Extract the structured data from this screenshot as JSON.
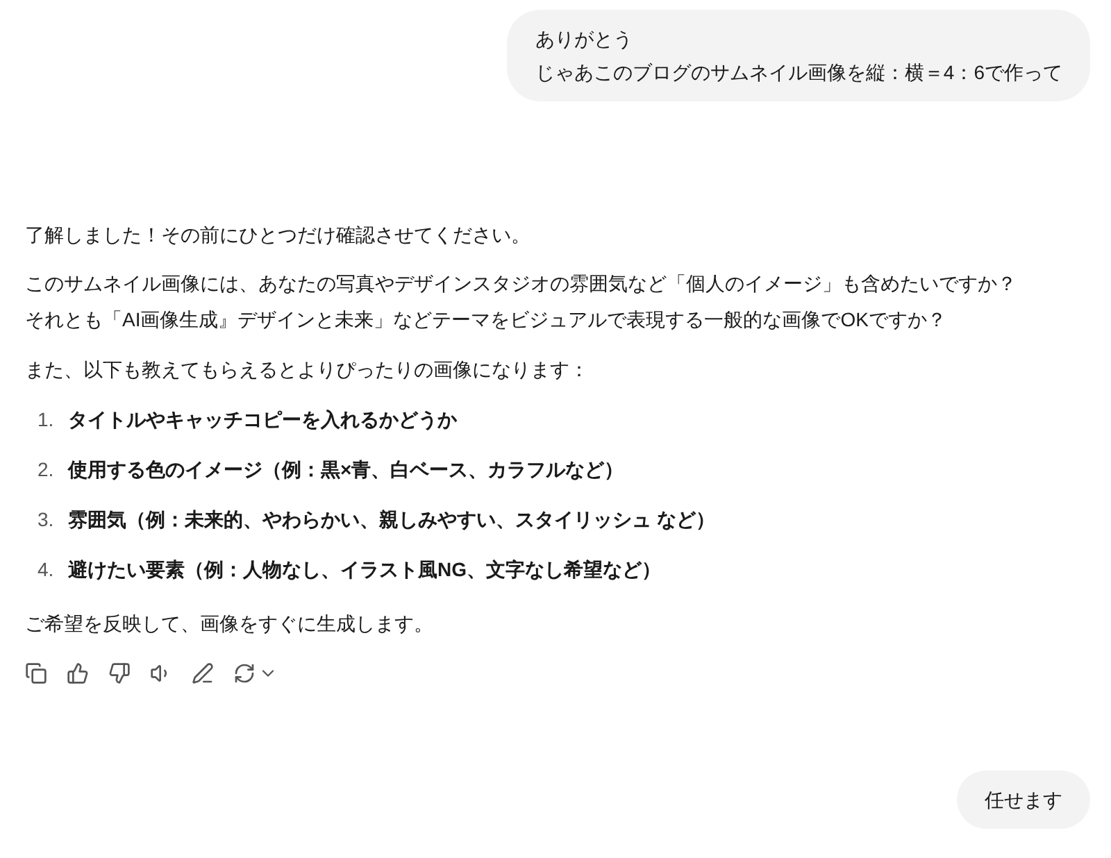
{
  "messages": [
    {
      "kind": "user",
      "lines": [
        "ありがとう",
        "じゃあこのブログのサムネイル画像を縦：横＝4：6で作って"
      ]
    },
    {
      "kind": "assistant",
      "intro": "了解しました！その前にひとつだけ確認させてください。",
      "paragraphs": [
        [
          "このサムネイル画像には、あなたの写真やデザインスタジオの雰囲気など「個人のイメージ」も含めたいですか？",
          "それとも「AI画像生成』デザインと未来」などテーマをビジュアルで表現する一般的な画像でOKですか？"
        ],
        [
          "また、以下も教えてもらえるとよりぴったりの画像になります："
        ]
      ],
      "list": [
        {
          "number": "1.",
          "text": "タイトルやキャッチコピーを入れるかどうか"
        },
        {
          "number": "2.",
          "text": "使用する色のイメージ（例：黒×青、白ベース、カラフルなど）"
        },
        {
          "number": "3.",
          "text": "雰囲気（例：未来的、やわらかい、親しみやすい、スタイリッシュ など）"
        },
        {
          "number": "4.",
          "text": "避けたい要素（例：人物なし、イラスト風NG、文字なし希望など）"
        }
      ],
      "closing": "ご希望を反映して、画像をすぐに生成します。"
    },
    {
      "kind": "user",
      "lines": [
        "任せます"
      ]
    }
  ]
}
